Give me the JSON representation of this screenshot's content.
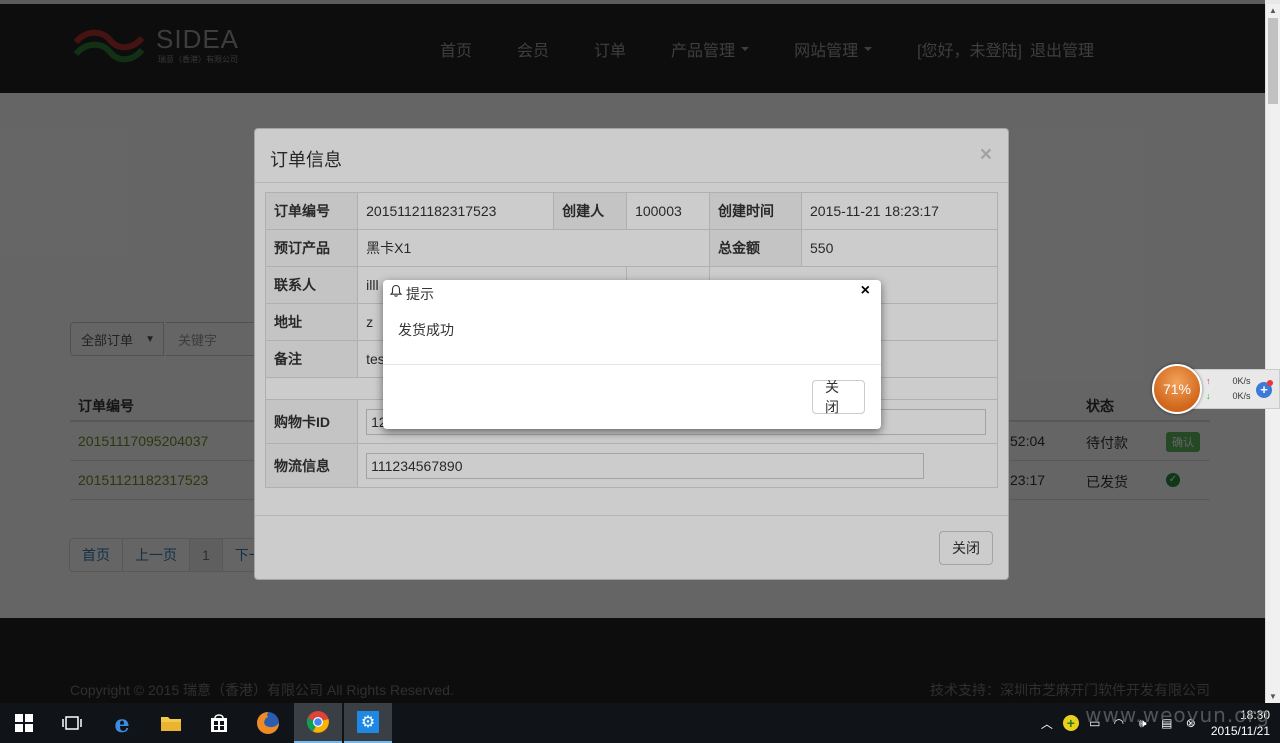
{
  "brand": {
    "name": "SIDEA",
    "subtitle": "瑞意（香港）有限公司"
  },
  "nav": {
    "home": "首页",
    "members": "会员",
    "orders": "订单",
    "products": "产品管理",
    "website": "网站管理",
    "user_status": "[您好，未登陆]",
    "logout": "退出管理"
  },
  "filter": {
    "select_value": "全部订单",
    "keyword_placeholder": "关键字"
  },
  "bg_table": {
    "headers": {
      "order_no": "订单编号",
      "status": "状态"
    },
    "rows": [
      {
        "order_no": "20151117095204037",
        "time_tail": "52:04",
        "status": "待付款",
        "badge": "确认"
      },
      {
        "order_no": "20151121182317523",
        "time_tail": "23:17",
        "status": "已发货"
      }
    ]
  },
  "pager": {
    "first": "首页",
    "prev": "上一页",
    "current": "1",
    "next": "下一页"
  },
  "footer": {
    "copyright": "Copyright © 2015 瑞意（香港）有限公司 All Rights Reserved.",
    "support": "技术支持：深圳市芝麻开门软件开发有限公司"
  },
  "order_modal": {
    "title": "订单信息",
    "close_x": "×",
    "labels": {
      "order_no": "订单编号",
      "creator": "创建人",
      "created_at": "创建时间",
      "product": "预订产品",
      "total": "总金额",
      "contact": "联系人",
      "address": "地址",
      "remark": "备注",
      "card_id": "购物卡ID",
      "logistics": "物流信息"
    },
    "values": {
      "order_no": "20151121182317523",
      "creator": "100003",
      "created_at": "2015-11-21 18:23:17",
      "product": "黑卡X1",
      "total": "550",
      "contact": "illl",
      "address": "z",
      "remark": "tes",
      "card_id": "12",
      "logistics": "111234567890"
    },
    "close_button": "关闭"
  },
  "alert_modal": {
    "title": "提示",
    "message": "发货成功",
    "close_x": "×",
    "close_button": "关闭"
  },
  "widget": {
    "percent": "71%",
    "up_speed": "0K/s",
    "down_speed": "0K/s"
  },
  "taskbar": {
    "clock_time": "18:30",
    "clock_date": "2015/11/21",
    "watermark": "www.weoyun.org"
  }
}
